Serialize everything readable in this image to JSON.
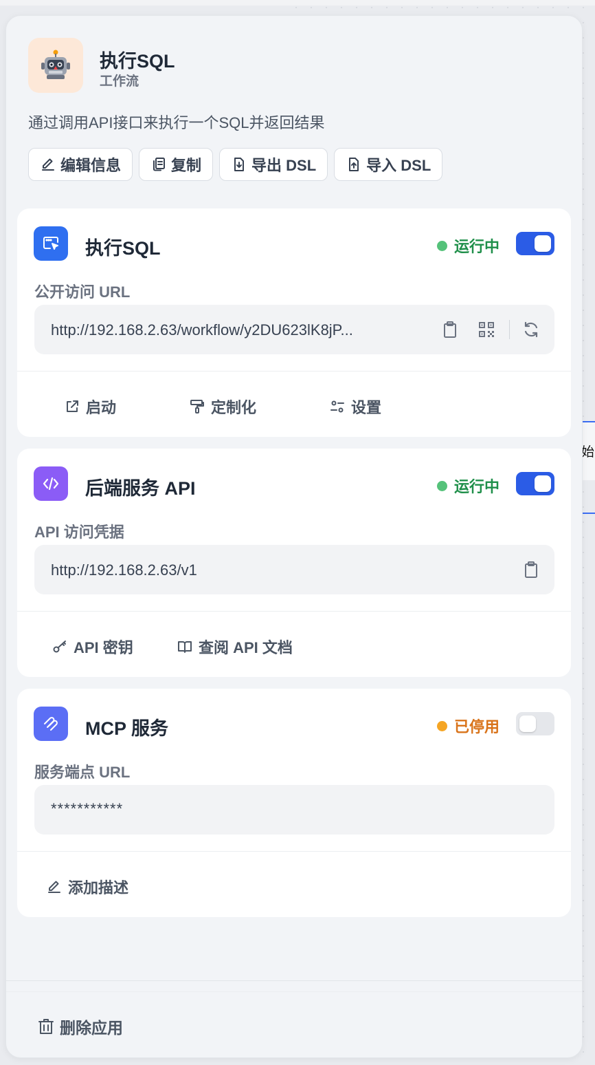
{
  "background": {
    "partial_node_text": "始"
  },
  "app": {
    "name": "执行SQL",
    "type": "工作流",
    "description": "通过调用API接口来执行一个SQL并返回结果",
    "avatar_icon": "robot-emoji"
  },
  "actions": {
    "edit": "编辑信息",
    "copy": "复制",
    "export": "导出 DSL",
    "import": "导入 DSL"
  },
  "webapp": {
    "title": "执行SQL",
    "status": "运行中",
    "enabled": true,
    "url_label": "公开访问 URL",
    "url": "http://192.168.2.63/workflow/y2DU623lK8jP...",
    "links": {
      "launch": "启动",
      "customize": "定制化",
      "settings": "设置"
    }
  },
  "api": {
    "title": "后端服务 API",
    "status": "运行中",
    "enabled": true,
    "url_label": "API 访问凭据",
    "url": "http://192.168.2.63/v1",
    "links": {
      "api_key": "API 密钥",
      "docs": "查阅 API 文档"
    }
  },
  "mcp": {
    "title": "MCP 服务",
    "status": "已停用",
    "enabled": false,
    "url_label": "服务端点 URL",
    "url": "***********",
    "links": {
      "add_desc": "添加描述"
    }
  },
  "footer": {
    "delete": "删除应用"
  },
  "colors": {
    "running_green": "#1f8f4a",
    "running_dot": "#55c27a",
    "stopped_orange": "#d9731a",
    "stopped_dot": "#f5a524",
    "toggle_on": "#2b5ce6",
    "toggle_off": "#e5e7eb"
  }
}
